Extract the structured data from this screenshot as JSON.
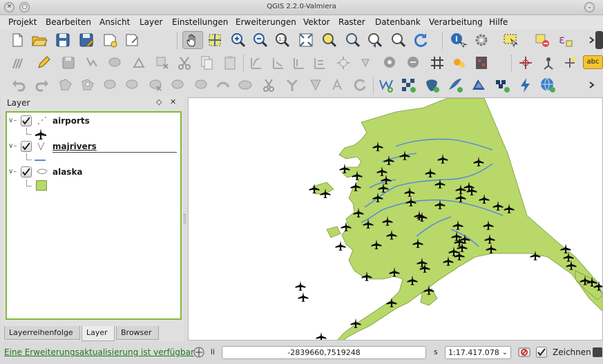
{
  "window": {
    "title": "QGIS 2.2.0-Valmiera"
  },
  "menu": {
    "items": [
      "Projekt",
      "Bearbeiten",
      "Ansicht",
      "Layer",
      "Einstellungen",
      "Erweiterungen",
      "Vektor",
      "Raster",
      "Datenbank",
      "Verarbeitung",
      "Hilfe"
    ]
  },
  "toolbar": {
    "label_badge": "abc"
  },
  "layers_panel": {
    "title": "Layer",
    "float_glyph": "◇",
    "close_glyph": "✕",
    "layers": [
      {
        "name": "airports",
        "checked": true,
        "geometry": "point"
      },
      {
        "name": "majrivers",
        "checked": true,
        "geometry": "line"
      },
      {
        "name": "alaska",
        "checked": true,
        "geometry": "polygon"
      }
    ],
    "tabs": [
      "Layerreihenfolge",
      "Layer",
      "Browser"
    ]
  },
  "colors": {
    "land": "#b9d86a",
    "river": "#5a8fd1",
    "accent_green": "#82b83d",
    "airport": "#0a0a0a"
  },
  "statusbar": {
    "update_link": "Eine Erweiterungsaktualisierung ist verfügbar",
    "coord_label": "li",
    "coordinates": "-2839660,7519248",
    "scale_label": "s",
    "scale": "1:17.417.078",
    "render_label": "Zeichnen"
  }
}
